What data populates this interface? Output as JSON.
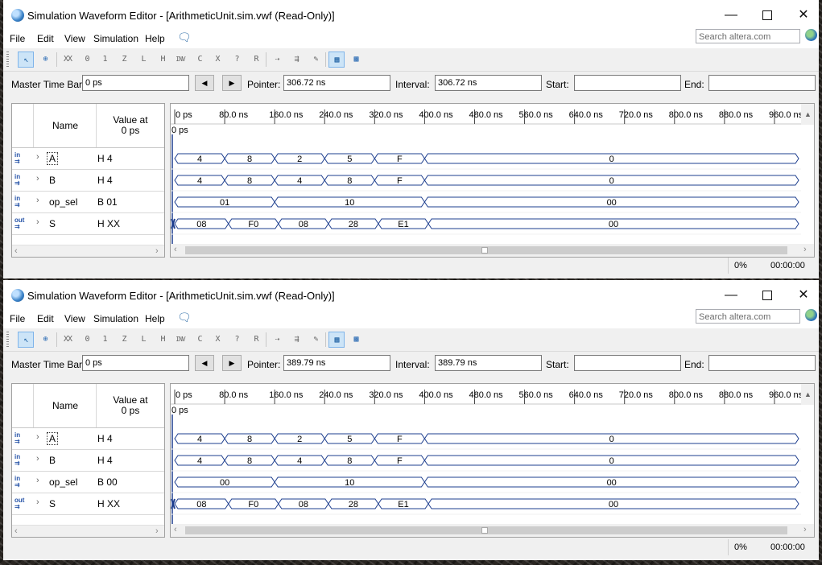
{
  "windows": [
    {
      "title": "Simulation Waveform Editor - [ArithmeticUnit.sim.vwf (Read-Only)]",
      "menu": [
        "File",
        "Edit",
        "View",
        "Simulation",
        "Help"
      ],
      "search_placeholder": "Search altera.com",
      "toolbar": [
        "XX",
        "0",
        "1",
        "Z",
        "L",
        "H",
        "INV",
        "C",
        "X",
        "?",
        "R"
      ],
      "timebar": {
        "master_label": "Master Time Bar:",
        "master_value": "0 ps",
        "pointer_label": "Pointer:",
        "pointer_value": "306.72 ns",
        "interval_label": "Interval:",
        "interval_value": "306.72 ns",
        "start_label": "Start:",
        "start_value": "",
        "end_label": "End:",
        "end_value": ""
      },
      "col_name": "Name",
      "col_value_line1": "Value at",
      "col_value_line2": "0 ps",
      "time_ticks": [
        "0 ps",
        "80.0 ns",
        "160.0 ns",
        "240.0 ns",
        "320.0 ns",
        "400.0 ns",
        "480.0 ns",
        "560.0 ns",
        "640.0 ns",
        "720.0 ns",
        "800.0 ns",
        "880.0 ns",
        "960.0 ns"
      ],
      "cursor_label": "0 ps",
      "signals": [
        {
          "pin": "in",
          "name": "A",
          "value": "H 4",
          "segments": [
            [
              "4",
              0,
              80
            ],
            [
              "8",
              80,
              160
            ],
            [
              "2",
              160,
              240
            ],
            [
              "5",
              240,
              320
            ],
            [
              "F",
              320,
              400
            ],
            [
              "0",
              400,
              1000
            ]
          ]
        },
        {
          "pin": "in",
          "name": "B",
          "value": "H 4",
          "segments": [
            [
              "4",
              0,
              80
            ],
            [
              "8",
              80,
              160
            ],
            [
              "4",
              160,
              240
            ],
            [
              "8",
              240,
              320
            ],
            [
              "F",
              320,
              400
            ],
            [
              "0",
              400,
              1000
            ]
          ]
        },
        {
          "pin": "in",
          "name": "op_sel",
          "value": "B 01",
          "segments": [
            [
              "01",
              0,
              160
            ],
            [
              "10",
              160,
              400
            ],
            [
              "00",
              400,
              1000
            ]
          ]
        },
        {
          "pin": "out",
          "name": "S",
          "value": "H XX",
          "segments": [
            [
              "08",
              0,
              86
            ],
            [
              "F0",
              86,
              166
            ],
            [
              "08",
              166,
              246
            ],
            [
              "28",
              246,
              326
            ],
            [
              "E1",
              326,
              406
            ],
            [
              "00",
              406,
              1000
            ]
          ]
        }
      ],
      "status": {
        "percent": "0%",
        "time": "00:00:00"
      }
    },
    {
      "title": "Simulation Waveform Editor - [ArithmeticUnit.sim.vwf (Read-Only)]",
      "menu": [
        "File",
        "Edit",
        "View",
        "Simulation",
        "Help"
      ],
      "search_placeholder": "Search altera.com",
      "toolbar": [
        "XX",
        "0",
        "1",
        "Z",
        "L",
        "H",
        "INV",
        "C",
        "X",
        "?",
        "R"
      ],
      "timebar": {
        "master_label": "Master Time Bar:",
        "master_value": "0 ps",
        "pointer_label": "Pointer:",
        "pointer_value": "389.79 ns",
        "interval_label": "Interval:",
        "interval_value": "389.79 ns",
        "start_label": "Start:",
        "start_value": "",
        "end_label": "End:",
        "end_value": ""
      },
      "col_name": "Name",
      "col_value_line1": "Value at",
      "col_value_line2": "0 ps",
      "time_ticks": [
        "0 ps",
        "80.0 ns",
        "160.0 ns",
        "240.0 ns",
        "320.0 ns",
        "400.0 ns",
        "480.0 ns",
        "560.0 ns",
        "640.0 ns",
        "720.0 ns",
        "800.0 ns",
        "880.0 ns",
        "960.0 ns"
      ],
      "cursor_label": "0 ps",
      "signals": [
        {
          "pin": "in",
          "name": "A",
          "value": "H 4",
          "segments": [
            [
              "4",
              0,
              80
            ],
            [
              "8",
              80,
              160
            ],
            [
              "2",
              160,
              240
            ],
            [
              "5",
              240,
              320
            ],
            [
              "F",
              320,
              400
            ],
            [
              "0",
              400,
              1000
            ]
          ]
        },
        {
          "pin": "in",
          "name": "B",
          "value": "H 4",
          "segments": [
            [
              "4",
              0,
              80
            ],
            [
              "8",
              80,
              160
            ],
            [
              "4",
              160,
              240
            ],
            [
              "8",
              240,
              320
            ],
            [
              "F",
              320,
              400
            ],
            [
              "0",
              400,
              1000
            ]
          ]
        },
        {
          "pin": "in",
          "name": "op_sel",
          "value": "B 00",
          "segments": [
            [
              "00",
              0,
              160
            ],
            [
              "10",
              160,
              400
            ],
            [
              "00",
              400,
              1000
            ]
          ]
        },
        {
          "pin": "out",
          "name": "S",
          "value": "H XX",
          "segments": [
            [
              "08",
              0,
              86
            ],
            [
              "F0",
              86,
              166
            ],
            [
              "08",
              166,
              246
            ],
            [
              "28",
              246,
              326
            ],
            [
              "E1",
              326,
              406
            ],
            [
              "00",
              406,
              1000
            ]
          ]
        }
      ],
      "status": {
        "percent": "0%",
        "time": "00:00:00"
      }
    }
  ]
}
